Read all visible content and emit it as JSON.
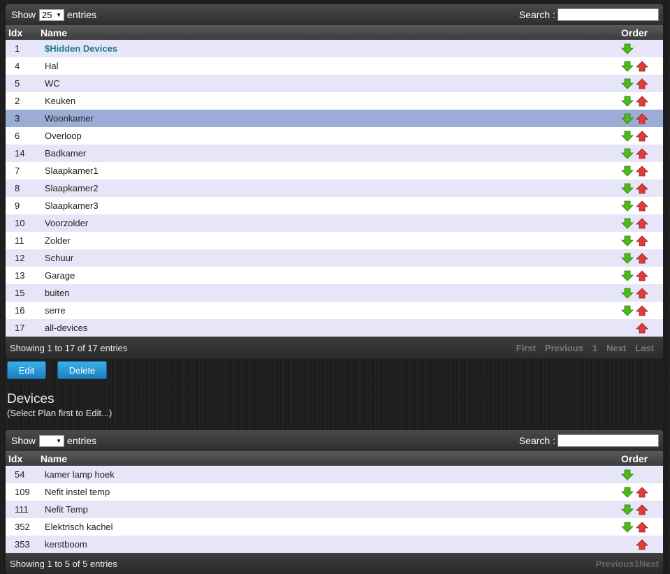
{
  "plans_table": {
    "show_label": "Show",
    "entries_label": "entries",
    "page_size": "25",
    "search_label": "Search :",
    "search_value": "",
    "columns": {
      "idx": "Idx",
      "name": "Name",
      "order": "Order"
    },
    "rows": [
      {
        "idx": "1",
        "name": "$Hidden Devices",
        "down": true,
        "up": false,
        "highlight": true
      },
      {
        "idx": "4",
        "name": "Hal",
        "down": true,
        "up": true
      },
      {
        "idx": "5",
        "name": "WC",
        "down": true,
        "up": true
      },
      {
        "idx": "2",
        "name": "Keuken",
        "down": true,
        "up": true
      },
      {
        "idx": "3",
        "name": "Woonkamer",
        "down": true,
        "up": true,
        "selected": true
      },
      {
        "idx": "6",
        "name": "Overloop",
        "down": true,
        "up": true
      },
      {
        "idx": "14",
        "name": "Badkamer",
        "down": true,
        "up": true
      },
      {
        "idx": "7",
        "name": "Slaapkamer1",
        "down": true,
        "up": true
      },
      {
        "idx": "8",
        "name": "Slaapkamer2",
        "down": true,
        "up": true
      },
      {
        "idx": "9",
        "name": "Slaapkamer3",
        "down": true,
        "up": true
      },
      {
        "idx": "10",
        "name": "Voorzolder",
        "down": true,
        "up": true
      },
      {
        "idx": "11",
        "name": "Zolder",
        "down": true,
        "up": true
      },
      {
        "idx": "12",
        "name": "Schuur",
        "down": true,
        "up": true
      },
      {
        "idx": "13",
        "name": "Garage",
        "down": true,
        "up": true
      },
      {
        "idx": "15",
        "name": "buiten",
        "down": true,
        "up": true
      },
      {
        "idx": "16",
        "name": "serre",
        "down": true,
        "up": true
      },
      {
        "idx": "17",
        "name": "all-devices",
        "down": false,
        "up": true
      }
    ],
    "info": "Showing 1 to 17 of 17 entries",
    "pager": {
      "first": "First",
      "previous": "Previous",
      "page": "1",
      "next": "Next",
      "last": "Last"
    }
  },
  "actions": {
    "edit": "Edit",
    "delete": "Delete"
  },
  "devices_section": {
    "title": "Devices",
    "subtitle": "(Select Plan first to Edit...)"
  },
  "devices_table": {
    "show_label": "Show",
    "entries_label": "entries",
    "page_size": "",
    "search_label": "Search :",
    "search_value": "",
    "columns": {
      "idx": "Idx",
      "name": "Name",
      "order": "Order"
    },
    "rows": [
      {
        "idx": "54",
        "name": "kamer lamp hoek",
        "down": true,
        "up": false
      },
      {
        "idx": "109",
        "name": "Nefit instel temp",
        "down": true,
        "up": true
      },
      {
        "idx": "111",
        "name": "Nefit Temp",
        "down": true,
        "up": true
      },
      {
        "idx": "352",
        "name": "Elektrisch kachel",
        "down": true,
        "up": true
      },
      {
        "idx": "353",
        "name": "kerstboom",
        "down": false,
        "up": true
      }
    ],
    "info": "Showing 1 to 5 of 5 entries",
    "pager": "Previous1Next"
  },
  "icons": {
    "down": "green-down-arrow-icon",
    "up": "red-up-arrow-icon"
  },
  "colors": {
    "down_arrow": "#4cbb17",
    "up_arrow": "#e03c3c",
    "selected_row": "#9badd6",
    "highlight_text": "#1a7a86"
  }
}
